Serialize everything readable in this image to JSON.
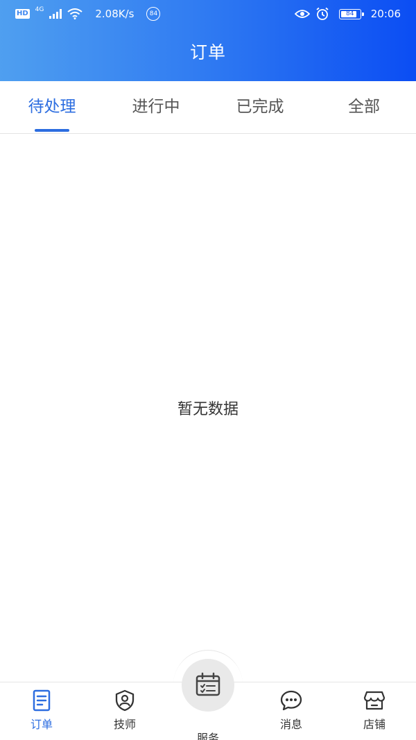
{
  "status_bar": {
    "hd": "HD",
    "network": "4G",
    "speed": "2.08K/s",
    "notification_count": "84",
    "battery": "84",
    "time": "20:06"
  },
  "header": {
    "title": "订单"
  },
  "tabs": [
    {
      "label": "待处理"
    },
    {
      "label": "进行中"
    },
    {
      "label": "已完成"
    },
    {
      "label": "全部"
    }
  ],
  "empty_state": {
    "text": "暂无数据"
  },
  "bottom_nav": {
    "items": [
      {
        "label": "订单",
        "icon": "order-icon"
      },
      {
        "label": "技师",
        "icon": "technician-shield-icon"
      },
      {
        "label": "服务",
        "icon": "service-calendar-icon"
      },
      {
        "label": "消息",
        "icon": "message-bubble-icon"
      },
      {
        "label": "店铺",
        "icon": "store-icon"
      }
    ]
  },
  "colors": {
    "accent": "#2c6de0",
    "header_gradient_start": "#4f9ff0",
    "header_gradient_end": "#0b4df3"
  }
}
